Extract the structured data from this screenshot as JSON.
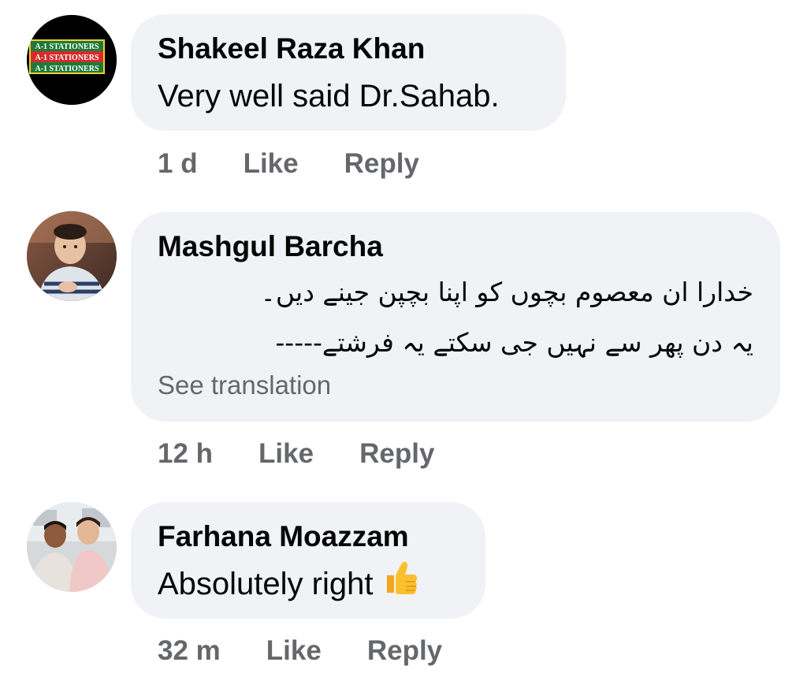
{
  "comments": [
    {
      "author": "Shakeel Raza Khan",
      "text": "Very well said Dr.Sahab.",
      "time": "1 d",
      "like_label": "Like",
      "reply_label": "Reply",
      "avatar": {
        "icon": "stationers-logo-avatar",
        "logo_lines": [
          "A-1 STATIONERS",
          "A-1 STATIONERS",
          "A-1 STATIONERS"
        ]
      }
    },
    {
      "author": "Mashgul Barcha",
      "text_lines": [
        "خدارا ان معصوم بچوں کو اپنا بچپن جینے دیں۔",
        "یہ دن پھر سے نہیں  جی سکتے یہ فرشتے-----"
      ],
      "see_translation": "See translation",
      "time": "12 h",
      "like_label": "Like",
      "reply_label": "Reply",
      "avatar": {
        "icon": "child-photo-avatar"
      }
    },
    {
      "author": "Farhana Moazzam",
      "text": "Absolutely right",
      "emoji": "thumbs-up-icon",
      "time": "32 m",
      "like_label": "Like",
      "reply_label": "Reply",
      "avatar": {
        "icon": "two-men-photo-avatar"
      }
    }
  ],
  "colors": {
    "bubble_bg": "#f0f2f5",
    "meta_text": "#65676b",
    "primary_text": "#050505"
  }
}
